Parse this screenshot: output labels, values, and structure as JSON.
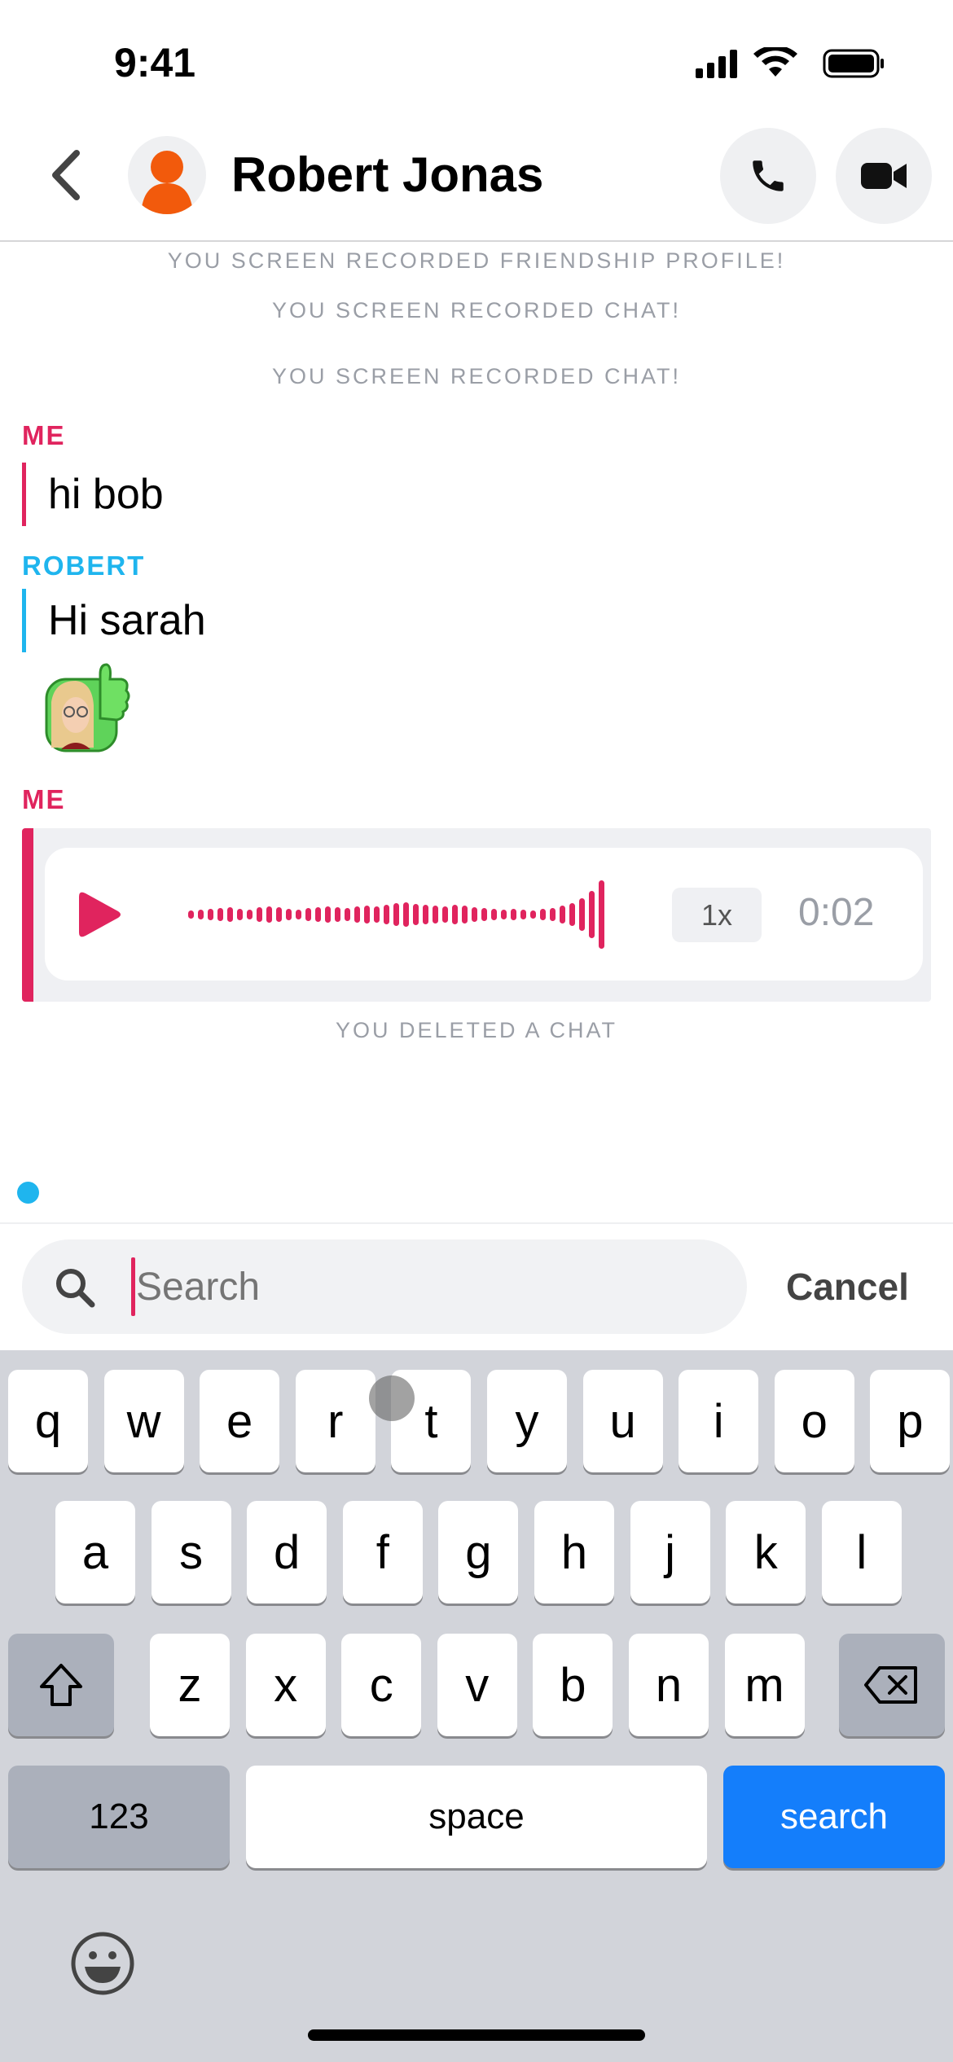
{
  "status_bar": {
    "time": "9:41"
  },
  "header": {
    "contact_name": "Robert Jonas",
    "icons": [
      "back-chevron",
      "avatar",
      "phone",
      "video-camera"
    ]
  },
  "chat": {
    "system_messages_top": [
      "YOU SCREEN RECORDED FRIENDSHIP PROFILE!",
      "YOU SCREEN RECORDED CHAT!",
      "YOU SCREEN RECORDED CHAT!"
    ],
    "messages": [
      {
        "sender": "ME",
        "text": "hi bob"
      },
      {
        "sender": "ROBERT",
        "text": "Hi sarah"
      },
      {
        "sender": "ME",
        "type": "voice",
        "speed": "1x",
        "duration": "0:02"
      }
    ],
    "system_message_bottom": "YOU DELETED A CHAT",
    "colors": {
      "me": "#e0245e",
      "robert": "#1fb5ee"
    }
  },
  "search": {
    "placeholder": "Search",
    "cancel_label": "Cancel"
  },
  "keyboard": {
    "row1": [
      "q",
      "w",
      "e",
      "r",
      "t",
      "y",
      "u",
      "i",
      "o",
      "p"
    ],
    "row2": [
      "a",
      "s",
      "d",
      "f",
      "g",
      "h",
      "j",
      "k",
      "l"
    ],
    "row3": [
      "z",
      "x",
      "c",
      "v",
      "b",
      "n",
      "m"
    ],
    "numbers_label": "123",
    "space_label": "space",
    "search_label": "search",
    "search_color": "#147efb"
  }
}
